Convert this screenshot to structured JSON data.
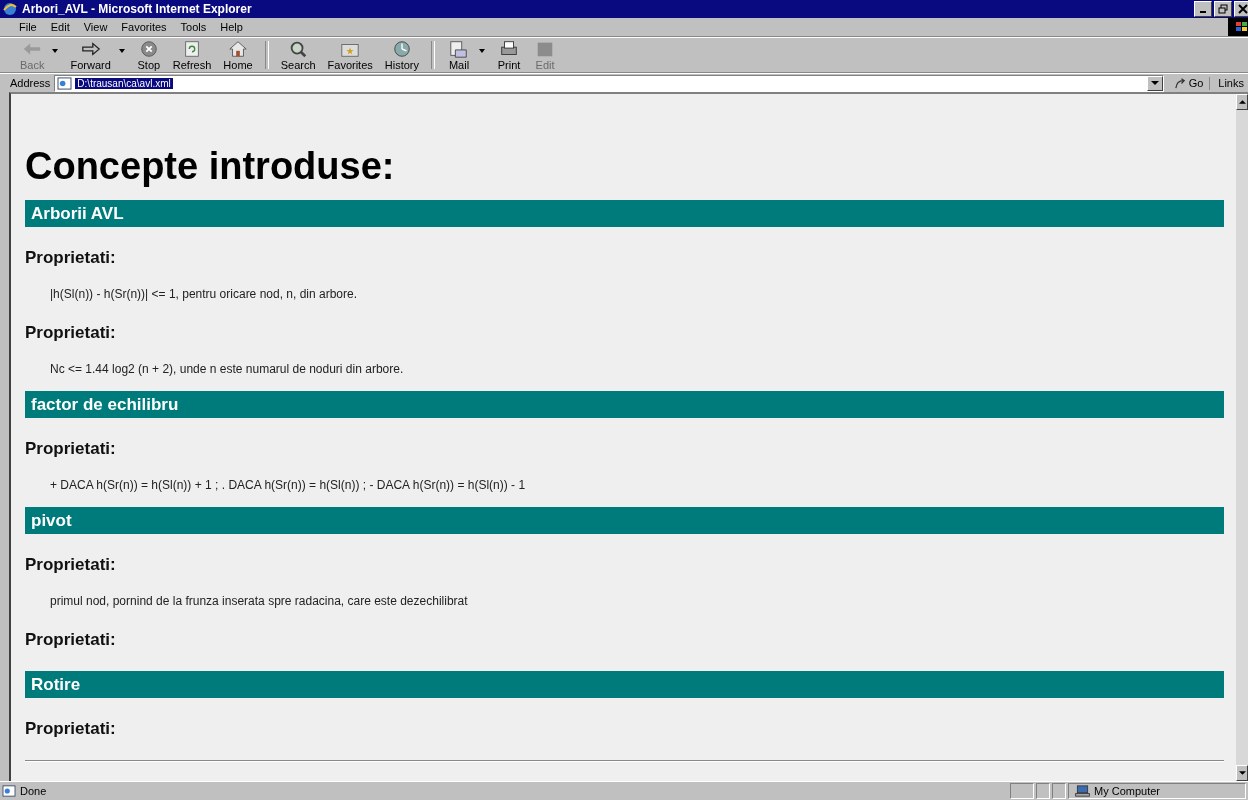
{
  "window": {
    "title": "Arbori_AVL - Microsoft Internet Explorer"
  },
  "menu": [
    "File",
    "Edit",
    "View",
    "Favorites",
    "Tools",
    "Help"
  ],
  "toolbar": [
    {
      "label": "Back",
      "kind": "back",
      "disabled": true,
      "dropdown": true
    },
    {
      "label": "Forward",
      "kind": "forward",
      "disabled": false,
      "dropdown": true
    },
    {
      "label": "Stop",
      "kind": "stop",
      "disabled": false,
      "dropdown": false
    },
    {
      "label": "Refresh",
      "kind": "refresh",
      "disabled": false,
      "dropdown": false
    },
    {
      "label": "Home",
      "kind": "home",
      "disabled": false,
      "dropdown": false
    },
    {
      "label": "Search",
      "kind": "search",
      "disabled": false,
      "dropdown": false
    },
    {
      "label": "Favorites",
      "kind": "favorites",
      "disabled": false,
      "dropdown": false
    },
    {
      "label": "History",
      "kind": "history",
      "disabled": false,
      "dropdown": false
    },
    {
      "label": "Mail",
      "kind": "mail",
      "disabled": false,
      "dropdown": true
    },
    {
      "label": "Print",
      "kind": "print",
      "disabled": false,
      "dropdown": false
    },
    {
      "label": "Edit",
      "kind": "edit",
      "disabled": true,
      "dropdown": false
    }
  ],
  "address_bar": {
    "label": "Address",
    "value": "D:\\trausan\\ca\\avl.xml",
    "go": "Go",
    "links": "Links"
  },
  "page": {
    "heading": "Concepte introduse:",
    "concepts": [
      {
        "name": "Arborii AVL",
        "properties": [
          {
            "label": "Proprietati:",
            "text": "|h(Sl(n)) - h(Sr(n))| <= 1, pentru oricare nod, n, din arbore."
          },
          {
            "label": "Proprietati:",
            "text": "Nc <= 1.44 log2 (n + 2), unde n este numarul de noduri din arbore."
          }
        ]
      },
      {
        "name": "factor de echilibru",
        "properties": [
          {
            "label": "Proprietati:",
            "text": "+ DACA h(Sr(n)) = h(Sl(n)) + 1 ; . DACA h(Sr(n)) = h(Sl(n)) ; - DACA h(Sr(n)) = h(Sl(n)) - 1"
          }
        ]
      },
      {
        "name": "pivot",
        "properties": [
          {
            "label": "Proprietati:",
            "text": "primul nod, pornind de la frunza inserata spre radacina, care este dezechilibrat"
          },
          {
            "label": "Proprietati:"
          }
        ]
      },
      {
        "name": "Rotire",
        "properties": [
          {
            "label": "Proprietati:"
          }
        ]
      }
    ]
  },
  "status_bar": {
    "text": "Done",
    "zone": "My Computer"
  }
}
